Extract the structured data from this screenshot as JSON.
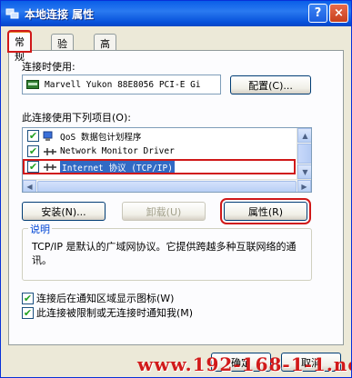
{
  "window": {
    "title": "本地连接 属性",
    "help_label": "?",
    "close_label": "×"
  },
  "tabs": [
    {
      "label": "常规",
      "active": true
    },
    {
      "label": "验证",
      "active": false
    },
    {
      "label": "高级",
      "active": false
    }
  ],
  "connect_using": {
    "label": "连接时使用:",
    "adapter": "Marvell Yukon 88E8056 PCI-E Gi",
    "configure_label": "配置(C)..."
  },
  "items_section": {
    "label": "此连接使用下列项目(O):",
    "items": [
      {
        "text": "QoS 数据包计划程序",
        "checked": true,
        "icon": "qos-icon"
      },
      {
        "text": "Network Monitor Driver",
        "checked": true,
        "icon": "network-icon"
      },
      {
        "text": "Internet 协议 (TCP/IP)",
        "checked": true,
        "icon": "network-icon"
      }
    ]
  },
  "item_buttons": {
    "install": "安装(N)...",
    "uninstall": "卸载(U)",
    "properties": "属性(R)"
  },
  "description": {
    "title": "说明",
    "text": "TCP/IP 是默认的广域网协议。它提供跨越多种互联网络的通讯。"
  },
  "options": [
    {
      "label": "连接后在通知区域显示图标(W)",
      "checked": true
    },
    {
      "label": "此连接被限制或无连接时通知我(M)",
      "checked": true
    }
  ],
  "footer": {
    "ok_label": "确定",
    "cancel_label": "取消"
  },
  "watermark": "www.192-168-1-1.net.cn",
  "colors": {
    "title_bar": "#0a5ee8",
    "highlight_box": "#d01818",
    "watermark": "#d11a1a"
  }
}
